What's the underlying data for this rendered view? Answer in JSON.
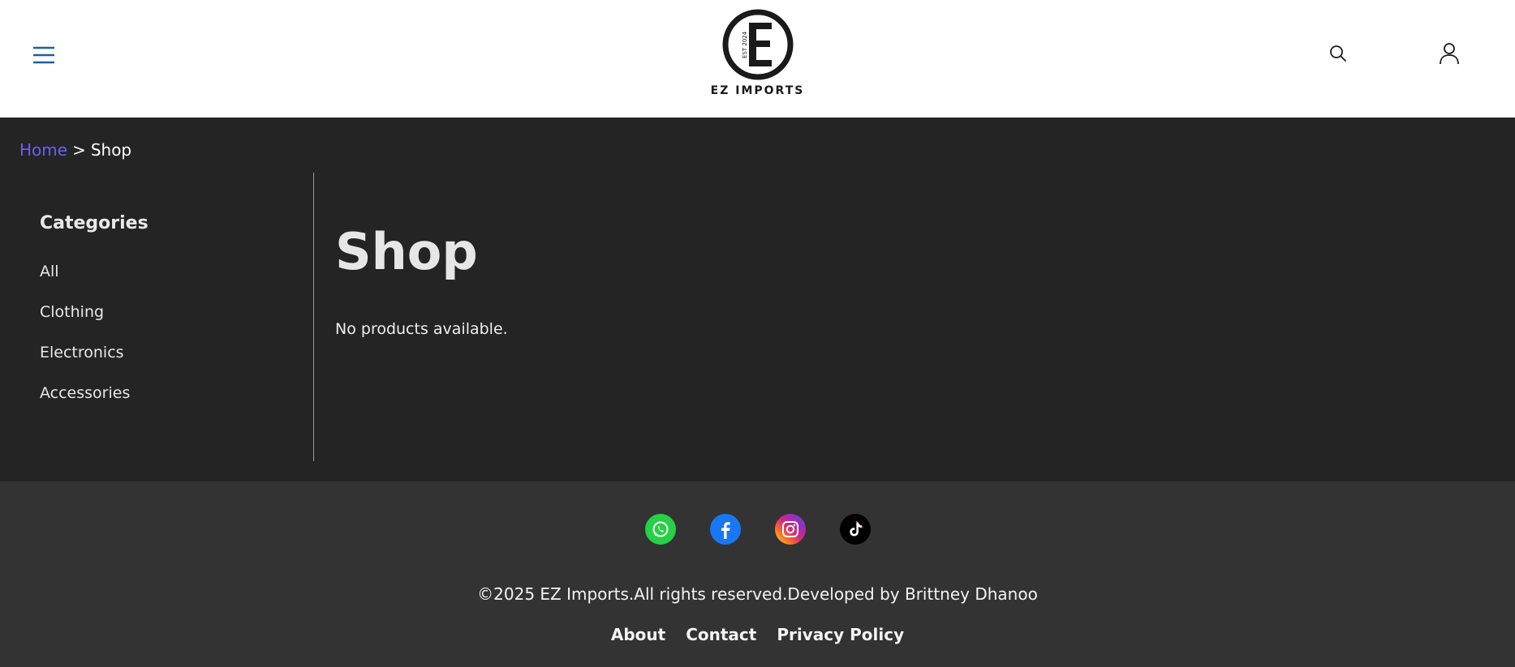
{
  "header": {
    "menu_icon": "hamburger-icon",
    "logo_text": "EZ IMPORTS",
    "logo_mark_text": "EST 2024",
    "search_icon": "search-icon",
    "account_icon": "user-icon"
  },
  "breadcrumb": {
    "home": "Home",
    "separator": ">",
    "current": "Shop"
  },
  "sidebar": {
    "title": "Categories",
    "items": [
      "All",
      "Clothing",
      "Electronics",
      "Accessories"
    ]
  },
  "main": {
    "title": "Shop",
    "empty_message": "No products available."
  },
  "footer": {
    "social": [
      "whatsapp-icon",
      "facebook-icon",
      "instagram-icon",
      "tiktok-icon"
    ],
    "copyright": "©2025 EZ Imports.All rights reserved.Developed by Brittney Dhanoo",
    "links": [
      "About",
      "Contact",
      "Privacy Policy"
    ]
  },
  "colors": {
    "header_bg": "#ffffff",
    "main_bg": "#242424",
    "footer_bg": "#333333",
    "link_accent": "#6b5cff",
    "menu_icon": "#1f5fa0"
  }
}
